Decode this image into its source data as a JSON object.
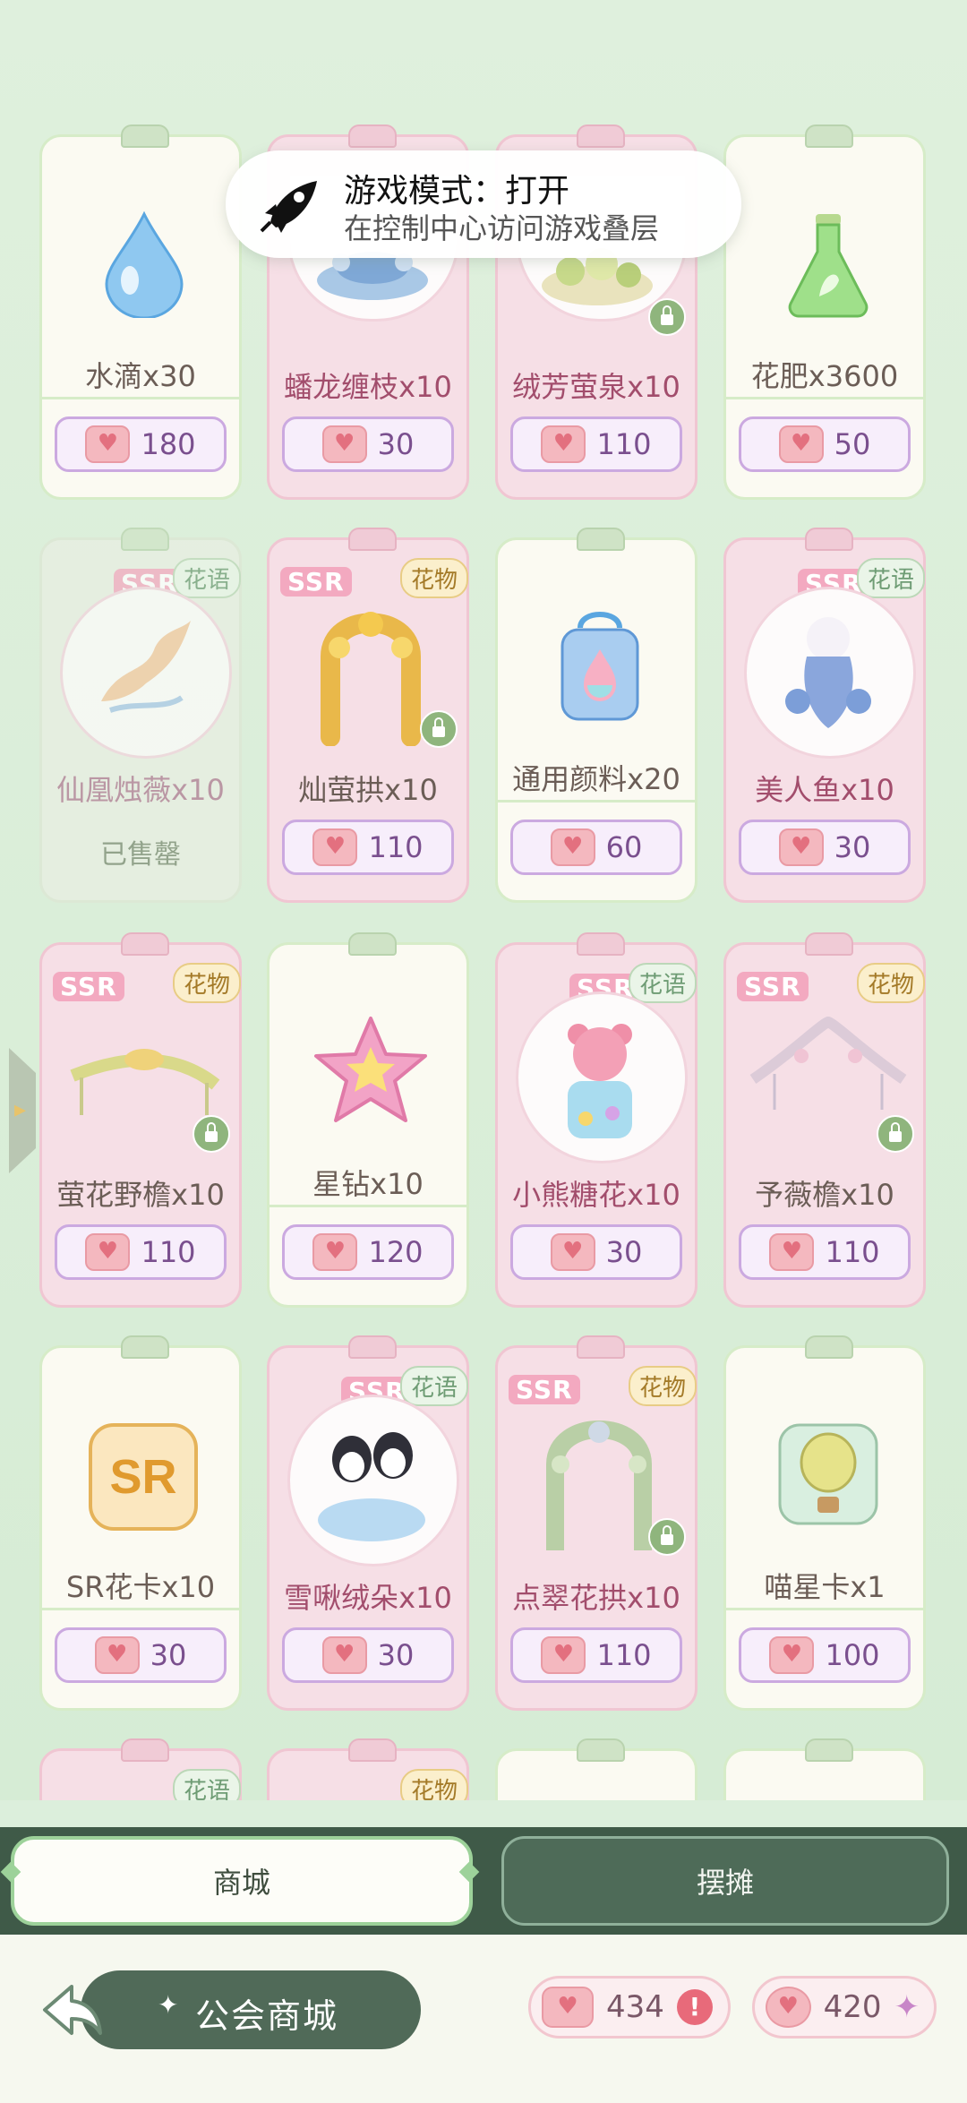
{
  "toast": {
    "title": "游戏模式：打开",
    "subtitle": "在控制中心访问游戏叠层",
    "icon": "rocket-icon"
  },
  "labels": {
    "ssr": "SSR",
    "tag_huayu": "花语",
    "tag_huawu": "花物",
    "sold_out": "已售罄"
  },
  "items": [
    {
      "name": "水滴x30",
      "price": "180",
      "style": "white",
      "icon": "water-drop-icon"
    },
    {
      "name": "蟠龙缠枝x10",
      "price": "30",
      "style": "pink",
      "icon": "dragon-branch-icon"
    },
    {
      "name": "绒芳萤泉x10",
      "price": "110",
      "style": "pink",
      "icon": "flower-fountain-icon",
      "locked": true
    },
    {
      "name": "花肥x3600",
      "price": "50",
      "style": "white",
      "icon": "fertilizer-flask-icon"
    },
    {
      "name": "仙凰烛薇x10",
      "price": "",
      "style": "sold",
      "icon": "phoenix-icon",
      "tag": "花语"
    },
    {
      "name": "灿萤拱x10",
      "price": "110",
      "style": "pink",
      "icon": "flower-arch-icon",
      "tag": "花物",
      "locked": true
    },
    {
      "name": "通用颜料x20",
      "price": "60",
      "style": "white",
      "icon": "paint-jar-icon"
    },
    {
      "name": "美人鱼x10",
      "price": "30",
      "style": "pink",
      "icon": "mermaid-icon",
      "tag": "花语"
    },
    {
      "name": "萤花野檐x10",
      "price": "110",
      "style": "pink",
      "icon": "flower-eaves-icon",
      "tag": "花物",
      "locked": true
    },
    {
      "name": "星钻x10",
      "price": "120",
      "style": "white",
      "icon": "star-diamond-icon"
    },
    {
      "name": "小熊糖花x10",
      "price": "30",
      "style": "pink",
      "icon": "bear-candy-icon",
      "tag": "花语"
    },
    {
      "name": "予薇檐x10",
      "price": "110",
      "style": "pink",
      "icon": "rose-eaves-icon",
      "tag": "花物",
      "locked": true
    },
    {
      "name": "SR花卡x10",
      "price": "30",
      "style": "white",
      "icon": "sr-card-icon"
    },
    {
      "name": "雪啾绒朵x10",
      "price": "30",
      "style": "pink",
      "icon": "penguin-icon",
      "tag": "花语"
    },
    {
      "name": "点翠花拱x10",
      "price": "110",
      "style": "pink",
      "icon": "green-arch-icon",
      "tag": "花物",
      "locked": true
    },
    {
      "name": "喵星卡x1",
      "price": "100",
      "style": "white",
      "icon": "balloon-card-icon"
    }
  ],
  "partial_tags": [
    "花语",
    "花物"
  ],
  "tabs": {
    "active": "商城",
    "inactive": "摆摊"
  },
  "footer": {
    "title": "公会商城",
    "currency_a": "434",
    "currency_b": "420"
  }
}
